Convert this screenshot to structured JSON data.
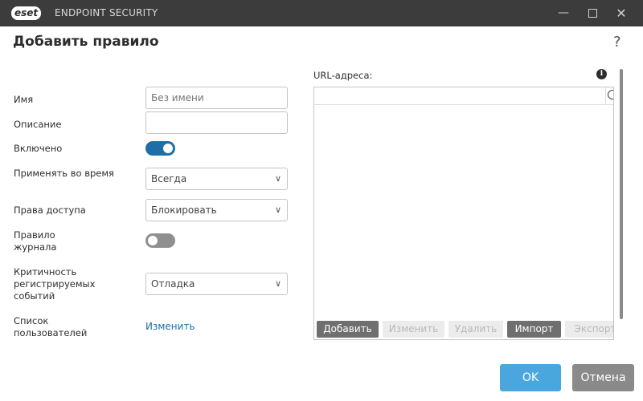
{
  "window": {
    "logo_text": "eset",
    "app_name": "ENDPOINT SECURITY",
    "minimize": "—",
    "close": "✕"
  },
  "dialog": {
    "title": "Добавить правило",
    "help": "?"
  },
  "form": {
    "name_label": "Имя",
    "name_placeholder": "Без имени",
    "name_value": "",
    "description_label": "Описание",
    "description_value": "",
    "enabled_label": "Включено",
    "enabled": true,
    "apply_label": "Применять во время",
    "apply_value": "Всегда",
    "access_label": "Права доступа",
    "access_value": "Блокировать",
    "log_label": "Правило журнала",
    "log_enabled": false,
    "severity_label": "Критичность регистрируемых событий",
    "severity_value": "Отладка",
    "users_label": "Список пользователей",
    "users_link": "Изменить"
  },
  "urls": {
    "label": "URL-адреса:",
    "info": "i",
    "toolbar": [
      {
        "label": "Добавить",
        "enabled": true
      },
      {
        "label": "Изменить",
        "enabled": false
      },
      {
        "label": "Удалить",
        "enabled": false
      },
      {
        "label": "Импорт",
        "enabled": true
      },
      {
        "label": "Экспорт",
        "enabled": false
      }
    ]
  },
  "footer": {
    "ok": "OK",
    "cancel": "Отмена"
  },
  "colors": {
    "accent": "#1d6fa5",
    "ok_button": "#4aa7dd",
    "titlebar": "#3c3c3c"
  }
}
